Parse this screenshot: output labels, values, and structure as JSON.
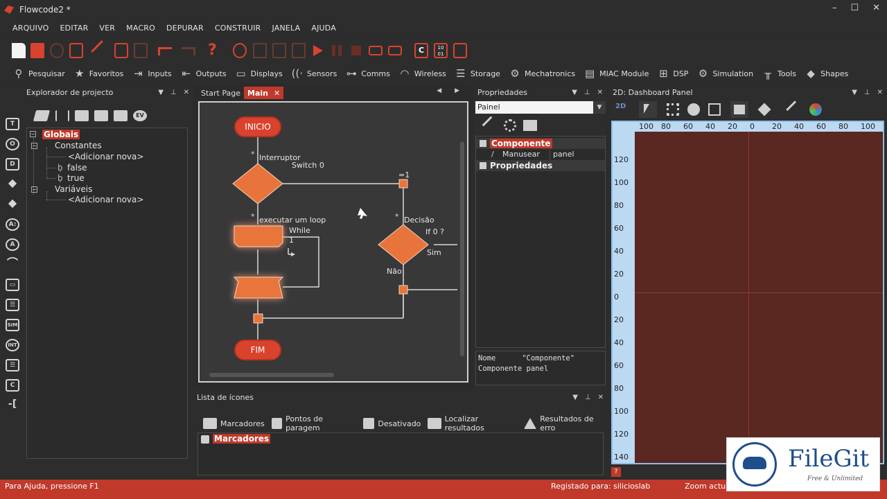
{
  "window": {
    "title": "Flowcode2 *",
    "controls": [
      "–",
      "☐",
      "✕"
    ]
  },
  "menu": [
    "ARQUIVO",
    "EDITAR",
    "VER",
    "MACRO",
    "DEPURAR",
    "CONSTRUIR",
    "JANELA",
    "AJUDA"
  ],
  "toolbar1": {
    "compile_c_label": "C",
    "compile_bin_label": "10 01"
  },
  "categories": [
    "Pesquisar",
    "Favoritos",
    "Inputs",
    "Outputs",
    "Displays",
    "Sensors",
    "Comms",
    "Wireless",
    "Storage",
    "Mechatronics",
    "MIAC Module",
    "DSP",
    "Simulation",
    "Tools",
    "Shapes"
  ],
  "left_panel": {
    "title": "Explorador de projecto",
    "icons": [
      "T",
      "O",
      "D",
      "◆",
      "◆",
      "A:",
      "A",
      "⌒",
      "▭",
      "☰",
      "SIM",
      "INT",
      "☰",
      "C",
      "-["
    ],
    "tree": {
      "root": "Globais",
      "constants": "Constantes",
      "add_new_1": "<Adicionar nova>",
      "const_false": "false",
      "const_true": "true",
      "variables": "Variáveis",
      "add_new_2": "<Adicionar nova>"
    },
    "toolbar_ev": "EV"
  },
  "editor": {
    "tabs": [
      {
        "label": "Start Page",
        "active": false
      },
      {
        "label": "Main",
        "active": true,
        "close": "✕"
      }
    ],
    "nav": "◀ ▶",
    "flowchart": {
      "start": "INICIO",
      "end": "FIM",
      "interrupt_label": "Interruptor",
      "interrupt_sub": "Switch 0",
      "eq1": "=1",
      "loop_label": "executar um loop",
      "loop_while": "While",
      "loop_count": "1",
      "decision_label": "Decisão",
      "decision_cond": "If 0 ?",
      "yes": "Sim",
      "no": "Não",
      "star": "*"
    }
  },
  "iconlist": {
    "title": "Lista de ícones",
    "tabs": [
      "Marcadores",
      "Pontos de paragem",
      "Desativado",
      "Localizar resultados",
      "Resultados de erro"
    ],
    "selected_item": "Marcadores"
  },
  "props": {
    "title": "Propriedades",
    "select_value": "Painel",
    "cat_component": "Componente",
    "row_name": "Manusear",
    "row_value": "panel",
    "cat_props": "Propriedades",
    "desc": "Nome      \"Componente\"\nComponente panel"
  },
  "dash": {
    "title": "2D: Dashboard Panel",
    "mode": "2D",
    "ruler_top": [
      "100",
      "80",
      "60",
      "40",
      "20",
      "0",
      "20",
      "40",
      "60",
      "80",
      "100"
    ],
    "ruler_left": [
      "120",
      "100",
      "80",
      "60",
      "40",
      "20",
      "0",
      "20",
      "40",
      "60",
      "80",
      "100",
      "120",
      "140"
    ],
    "canvas_color": "#5a2721"
  },
  "status": {
    "help": "Para Ajuda, pressione F1",
    "registered": "Registado para: silicioslab",
    "zoom": "Zoom actual"
  },
  "watermark": {
    "name": "FileGit",
    "tagline": "Free & Unlimited"
  },
  "colors": {
    "accent": "#c0392b",
    "shape": "#e8743b",
    "background": "#2d2d2d"
  }
}
